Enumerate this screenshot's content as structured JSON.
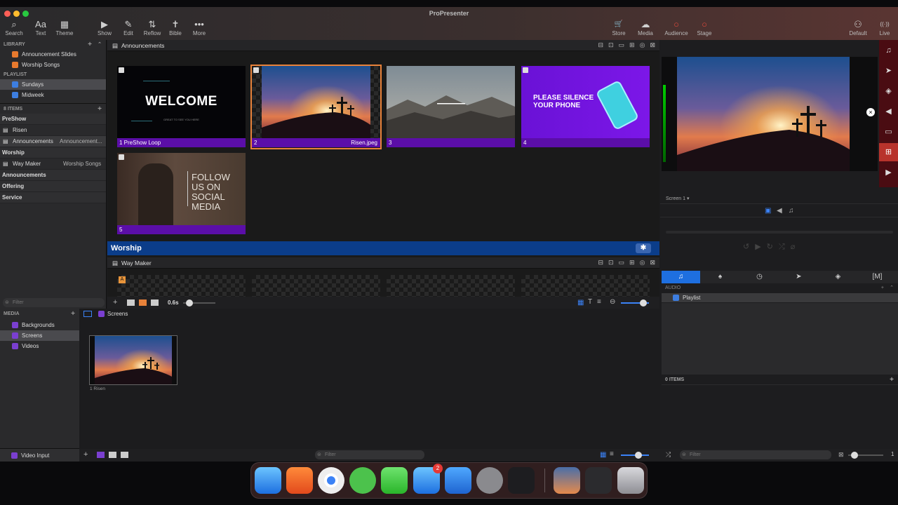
{
  "app": {
    "title": "ProPresenter"
  },
  "toolbar": {
    "left": [
      {
        "label": "Search",
        "icon": "⌕"
      },
      {
        "label": "Text",
        "icon": "Aa"
      },
      {
        "label": "Theme",
        "icon": "▦"
      },
      {
        "label": "Show",
        "icon": "▶"
      },
      {
        "label": "Edit",
        "icon": "✎"
      },
      {
        "label": "Reflow",
        "icon": "⇅"
      },
      {
        "label": "Bible",
        "icon": "✝"
      },
      {
        "label": "More",
        "icon": "•••"
      }
    ],
    "right": [
      {
        "label": "Store",
        "icon": "🛒"
      },
      {
        "label": "Media",
        "icon": "☁"
      },
      {
        "label": "Audience",
        "icon": "○"
      },
      {
        "label": "Stage",
        "icon": "○"
      },
      {
        "label": "Default",
        "icon": "⚇"
      },
      {
        "label": "Live",
        "icon": "((·))"
      }
    ]
  },
  "library": {
    "header": "LIBRARY",
    "items": [
      "Announcement Slides",
      "Worship Songs"
    ],
    "playlist_header": "PLAYLIST",
    "playlists": [
      "Sundays",
      "Midweek"
    ]
  },
  "playlist": {
    "count": "8 ITEMS",
    "rows": [
      {
        "name": "PreShow",
        "sub": "",
        "header": true
      },
      {
        "name": "Risen",
        "sub": "",
        "header": false
      },
      {
        "name": "Announcements",
        "sub": "Announcement...",
        "header": false
      },
      {
        "name": "Worship",
        "sub": "",
        "header": true
      },
      {
        "name": "Way Maker",
        "sub": "Worship Songs",
        "header": false
      },
      {
        "name": "Announcements",
        "sub": "",
        "header": true
      },
      {
        "name": "Offering",
        "sub": "",
        "header": true
      },
      {
        "name": "Service",
        "sub": "",
        "header": true
      }
    ],
    "filter": "Filter"
  },
  "main": {
    "announcements_title": "Announcements",
    "slides": [
      {
        "label": "1 PreShow Loop",
        "right": "",
        "text": "WELCOME",
        "subtext": "GREAT TO SEE YOU HERE"
      },
      {
        "label": "2",
        "right": "Risen.jpeg",
        "text": "",
        "subtext": ""
      },
      {
        "label": "3",
        "right": "",
        "text": "",
        "subtext": ""
      },
      {
        "label": "4",
        "right": "",
        "text": "PLEASE SILENCE YOUR PHONE",
        "subtext": ""
      },
      {
        "label": "5",
        "right": "",
        "text": "FOLLOW US ON SOCIAL MEDIA",
        "subtext": ""
      }
    ],
    "group_title": "Worship",
    "song_title": "Way Maker",
    "group_letter": "A",
    "speed": "0.6s"
  },
  "right_panel": {
    "screen": "Screen 1 ▾",
    "audio_header": "AUDIO",
    "audio_items": [
      "Playlist"
    ],
    "items_count": "0 ITEMS",
    "filter": "Filter",
    "page": "1"
  },
  "media": {
    "header": "MEDIA",
    "items": [
      "Backgrounds",
      "Screens",
      "Videos"
    ],
    "video_input": "Video Input",
    "bin_title": "Screens",
    "bin_items": [
      "1 Risen"
    ],
    "filter": "Filter"
  },
  "dock": {
    "mail_badge": "2"
  },
  "colors": {
    "accent_purple": "#5b0ea8",
    "group_blue": "#0b3d8a",
    "record_red": "#e24a3c"
  }
}
